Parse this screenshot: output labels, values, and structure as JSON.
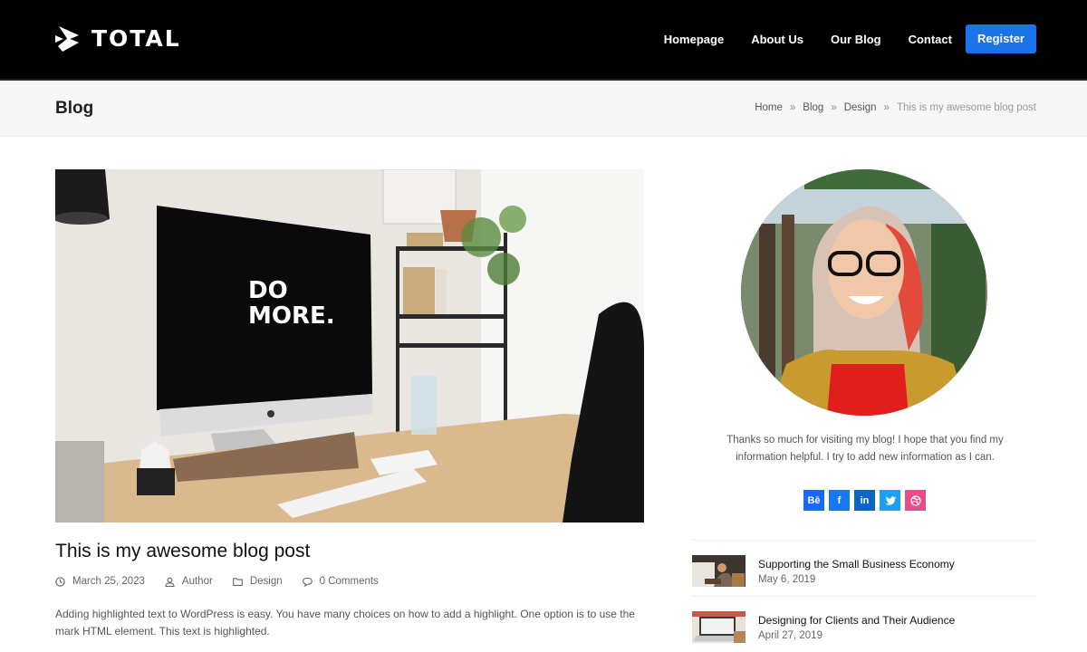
{
  "header": {
    "logo_text": "TOTAL",
    "logo_icon": "total-logo-icon",
    "nav": [
      {
        "label": "Homepage"
      },
      {
        "label": "About Us"
      },
      {
        "label": "Our Blog"
      },
      {
        "label": "Contact"
      }
    ],
    "register_label": "Register",
    "accent_color": "#1a73e8"
  },
  "page_header": {
    "title": "Blog",
    "breadcrumb": [
      {
        "label": "Home"
      },
      {
        "label": "Blog"
      },
      {
        "label": "Design"
      }
    ],
    "breadcrumb_separator": "»",
    "breadcrumb_current": "This is my awesome blog post"
  },
  "post": {
    "image_text_line1": "DO",
    "image_text_line2": "MORE.",
    "title": "This is my awesome blog post",
    "meta": {
      "date": "March 25, 2023",
      "author": "Author",
      "category": "Design",
      "comments": "0 Comments"
    },
    "excerpt": "Adding highlighted text to WordPress is easy. You have many choices on how to add a highlight. One option is to use the mark HTML element. This text is highlighted."
  },
  "sidebar": {
    "bio": "Thanks so much for visiting my blog! I hope that you find my information helpful. I try to add new information as I can.",
    "social": [
      {
        "name": "behance",
        "glyph": "Bē",
        "color": "#1769ff"
      },
      {
        "name": "facebook",
        "glyph": "f",
        "color": "#1877f2"
      },
      {
        "name": "linkedin",
        "glyph": "in",
        "color": "#0a66c2"
      },
      {
        "name": "twitter",
        "glyph": "🐦",
        "color": "#1da1f2"
      },
      {
        "name": "dribbble",
        "glyph": "◎",
        "color": "#ea4c89"
      }
    ],
    "recent_posts": [
      {
        "title": "Supporting the Small Business Economy",
        "date": "May 6, 2019"
      },
      {
        "title": "Designing for Clients and Their Audience",
        "date": "April 27, 2019"
      }
    ]
  }
}
